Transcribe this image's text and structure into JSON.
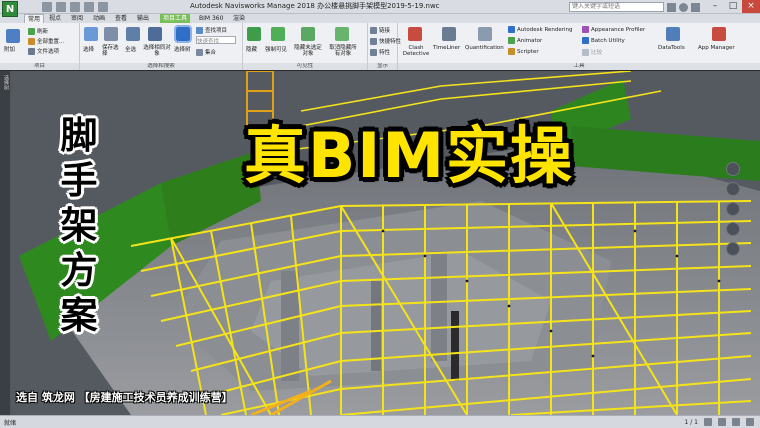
{
  "window": {
    "title": "Autodesk Navisworks Manage 2018    办公楼悬挑脚手架模型2019-5-19.nwc",
    "search_placeholder": "键入关键字或短语",
    "app_logo": "N"
  },
  "tabs": [
    {
      "label": "常用",
      "active": true
    },
    {
      "label": "视点"
    },
    {
      "label": "审阅"
    },
    {
      "label": "动画"
    },
    {
      "label": "查看"
    },
    {
      "label": "输出"
    },
    {
      "label": "项目工具",
      "context": true
    },
    {
      "label": "BIM 360"
    },
    {
      "label": "渲染"
    }
  ],
  "ribbon": {
    "project": {
      "label": "项目",
      "items": [
        "附加",
        "刷新",
        "全部重置...",
        "文件选项"
      ]
    },
    "select_search": {
      "label": "选择和搜索",
      "items": [
        "选择",
        "保存选择",
        "全选",
        "选择相同对象",
        "选择树",
        "查找项目",
        "快速查找",
        "集合"
      ]
    },
    "visibility": {
      "label": "可见性",
      "items": [
        "隐藏",
        "强制可见",
        "隐藏未选定对象",
        "取消隐藏所有对象"
      ]
    },
    "display": {
      "label": "显示",
      "items": [
        "链接",
        "快捷特性",
        "特性"
      ]
    },
    "tools": {
      "label": "工具",
      "items": [
        "Clash Detective",
        "TimeLiner",
        "Quantification",
        "Autodesk Rendering",
        "Animator",
        "Scripter",
        "Appearance Profiler",
        "Batch Utility",
        "比较",
        "DataTools",
        "App Manager"
      ]
    }
  },
  "sidebar": {
    "label": "选择树"
  },
  "overlay": {
    "headline": "真BIM实操",
    "vertical_title": "脚手架方案",
    "credit": "选自 筑龙网 【房建施工技术员养成训练营】"
  },
  "statusbar": {
    "text": "就绪",
    "counter": "1 / 1"
  },
  "colors": {
    "scaffold": "#f5e31a",
    "netting": "#2e8a1e",
    "concrete": "#8d9096",
    "accent": "#ffe400"
  }
}
